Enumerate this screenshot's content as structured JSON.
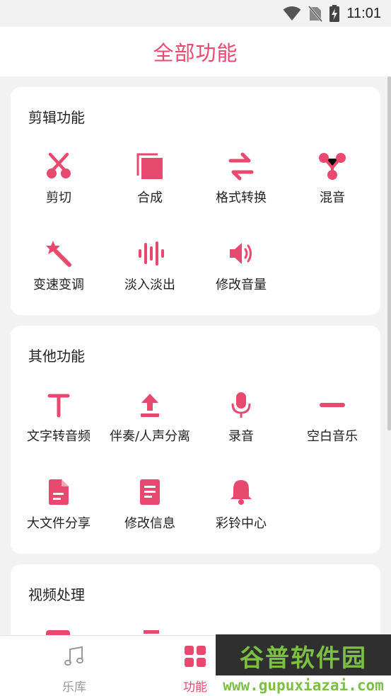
{
  "status_bar": {
    "time": "11:01",
    "icons": [
      "wifi-icon",
      "no-sim-icon",
      "battery-charging-icon"
    ]
  },
  "header": {
    "title": "全部功能"
  },
  "sections": [
    {
      "title": "剪辑功能",
      "items": [
        {
          "label": "剪切",
          "icon": "scissors-icon"
        },
        {
          "label": "合成",
          "icon": "merge-icon"
        },
        {
          "label": "格式转换",
          "icon": "convert-arrows-icon"
        },
        {
          "label": "混音",
          "icon": "mix-icon"
        },
        {
          "label": "变速变调",
          "icon": "magic-wand-icon"
        },
        {
          "label": "淡入淡出",
          "icon": "waveform-icon"
        },
        {
          "label": "修改音量",
          "icon": "volume-icon"
        }
      ]
    },
    {
      "title": "其他功能",
      "items": [
        {
          "label": "文字转音频",
          "icon": "text-icon"
        },
        {
          "label": "伴奏/人声分离",
          "icon": "upload-icon"
        },
        {
          "label": "录音",
          "icon": "microphone-icon"
        },
        {
          "label": "空白音乐",
          "icon": "minus-icon"
        },
        {
          "label": "大文件分享",
          "icon": "file-icon"
        },
        {
          "label": "修改信息",
          "icon": "document-icon"
        },
        {
          "label": "彩铃中心",
          "icon": "bell-icon"
        }
      ]
    },
    {
      "title": "视频处理",
      "items": []
    }
  ],
  "bottom_nav": {
    "items": [
      {
        "label": "乐库",
        "icon": "music-note-icon",
        "active": false
      },
      {
        "label": "功能",
        "icon": "grid-icon",
        "active": true
      }
    ]
  },
  "watermark": {
    "brand": "谷普软件园",
    "url": "www.gupuxiazai.com"
  },
  "colors": {
    "accent": "#e84a6f",
    "inactive": "#999999",
    "background": "#f2f2f2",
    "card": "#ffffff"
  }
}
